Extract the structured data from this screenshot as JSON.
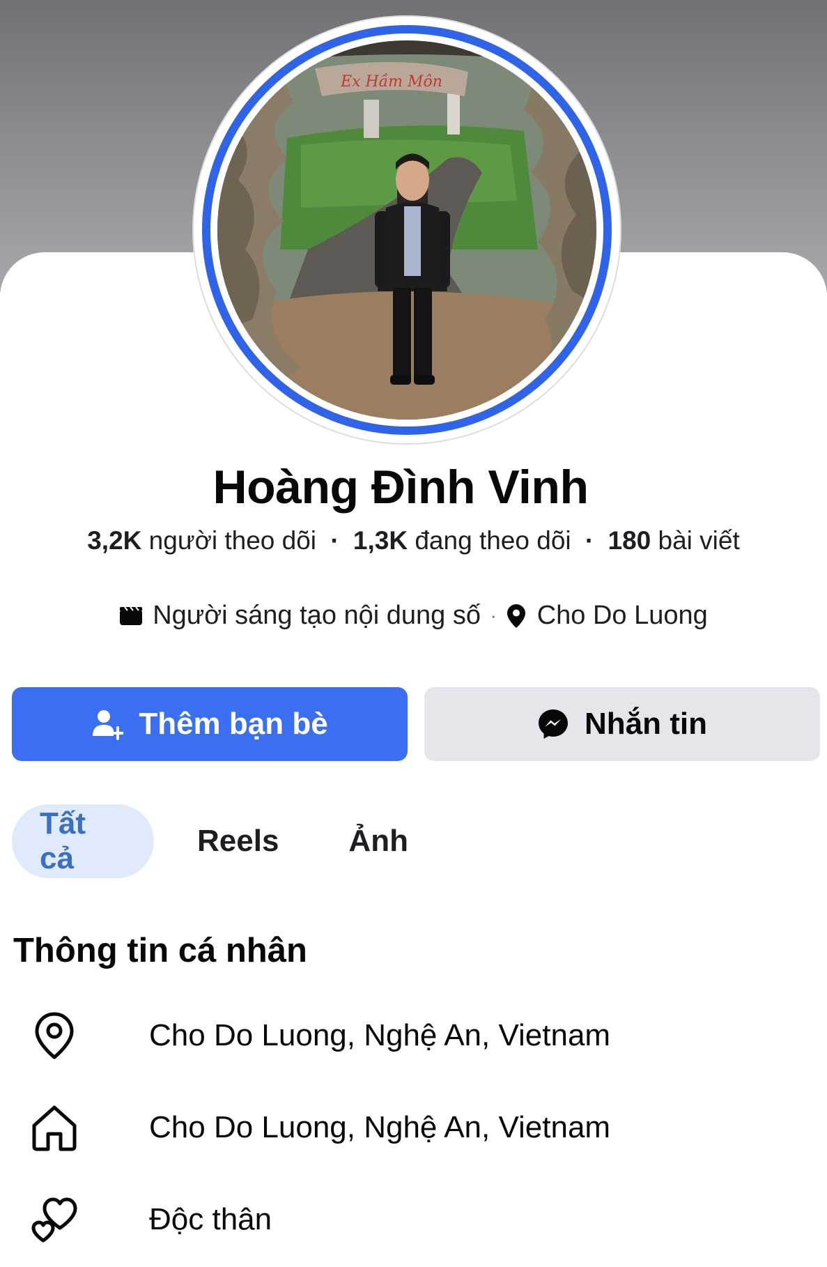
{
  "profile": {
    "name": "Hoàng Đình Vinh",
    "stats": {
      "followers_num": "3,2K",
      "followers_label": "người theo dõi",
      "following_num": "1,3K",
      "following_label": "đang theo dõi",
      "posts_num": "180",
      "posts_label": "bài viết",
      "separator": "·"
    },
    "meta": {
      "category_icon": "video-clapper-icon",
      "category": "Người sáng tạo nội dung số",
      "separator": "·",
      "location_icon": "location-pin-icon",
      "location": "Cho Do Luong"
    },
    "avatar_sign_text": "Ex Hầm Môn"
  },
  "actions": {
    "add_friend_label": "Thêm bạn bè",
    "add_friend_icon": "add-friend-icon",
    "message_label": "Nhắn tin",
    "message_icon": "messenger-icon"
  },
  "tabs": [
    {
      "label": "Tất cả",
      "active": true
    },
    {
      "label": "Reels",
      "active": false
    },
    {
      "label": "Ảnh",
      "active": false
    }
  ],
  "about": {
    "title": "Thông tin cá nhân",
    "items": [
      {
        "icon": "location-pin-outline-icon",
        "text": "Cho Do Luong, Nghệ An, Vietnam"
      },
      {
        "icon": "home-icon",
        "text": "Cho Do Luong, Nghệ An, Vietnam"
      },
      {
        "icon": "hearts-icon",
        "text": "Độc thân"
      }
    ]
  },
  "colors": {
    "primary": "#3a6ff2",
    "avatar_ring": "#2f64e8",
    "secondary_button": "#e4e6eb",
    "tab_active_bg": "#dfeafb",
    "tab_active_text": "#3a6fc4"
  }
}
